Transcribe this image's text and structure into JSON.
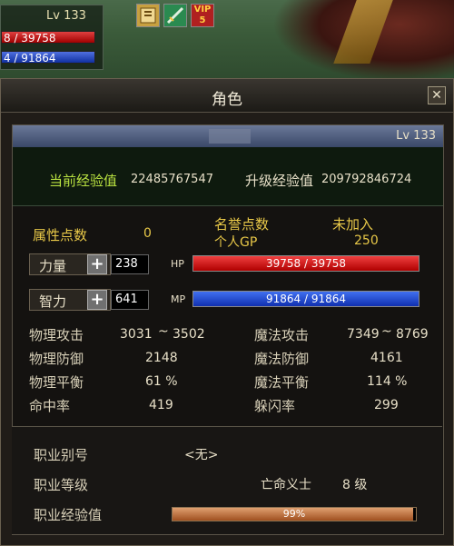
{
  "hud": {
    "level": "Lv 133",
    "hp_text": "8 / 39758",
    "mp_text": "4 / 91864"
  },
  "top_icons": [
    "scroll-icon",
    "sword-icon",
    "vip-icon"
  ],
  "vip": {
    "label": "VIP",
    "num": "5"
  },
  "window": {
    "title": "角色",
    "close": "✕"
  },
  "name_bar": {
    "level": "Lv 133"
  },
  "exp": {
    "current_label": "当前经验值",
    "current_value": "22485767547",
    "next_label": "升级经验值",
    "next_value": "209792846724"
  },
  "attr": {
    "points_label": "属性点数",
    "points_value": "0",
    "honor_label": "名誉点数",
    "gp_label": "个人GP",
    "guild_label": "未加入",
    "gp_value": "250"
  },
  "str": {
    "label": "力量",
    "value": "238",
    "bar_label": "HP",
    "bar_text": "39758 / 39758"
  },
  "int": {
    "label": "智力",
    "value": "641",
    "bar_label": "MP",
    "bar_text": "91864 / 91864"
  },
  "combat": {
    "patk_label": "物理攻击",
    "patk_min": "3031",
    "patk_sep": "~",
    "patk_max": "3502",
    "pdef_label": "物理防御",
    "pdef": "2148",
    "pbal_label": "物理平衡",
    "pbal": "61 %",
    "hit_label": "命中率",
    "hit": "419",
    "matk_label": "魔法攻击",
    "matk_min": "7349",
    "matk_sep": "~",
    "matk_max": "8769",
    "mdef_label": "魔法防御",
    "mdef": "4161",
    "mbal_label": "魔法平衡",
    "mbal": "114 %",
    "dodge_label": "躲闪率",
    "dodge": "299"
  },
  "job": {
    "alias_label": "职业别号",
    "alias": "<无>",
    "level_label": "职业等级",
    "job_name": "亡命义士",
    "job_level": "8 级",
    "exp_label": "职业经验值",
    "exp_pct_text": "99%",
    "exp_pct": 0.99
  },
  "colors": {
    "hp": "#d01010",
    "mp": "#2040d0",
    "label_gold": "#e8c848",
    "exp_green": "#b8e040"
  }
}
